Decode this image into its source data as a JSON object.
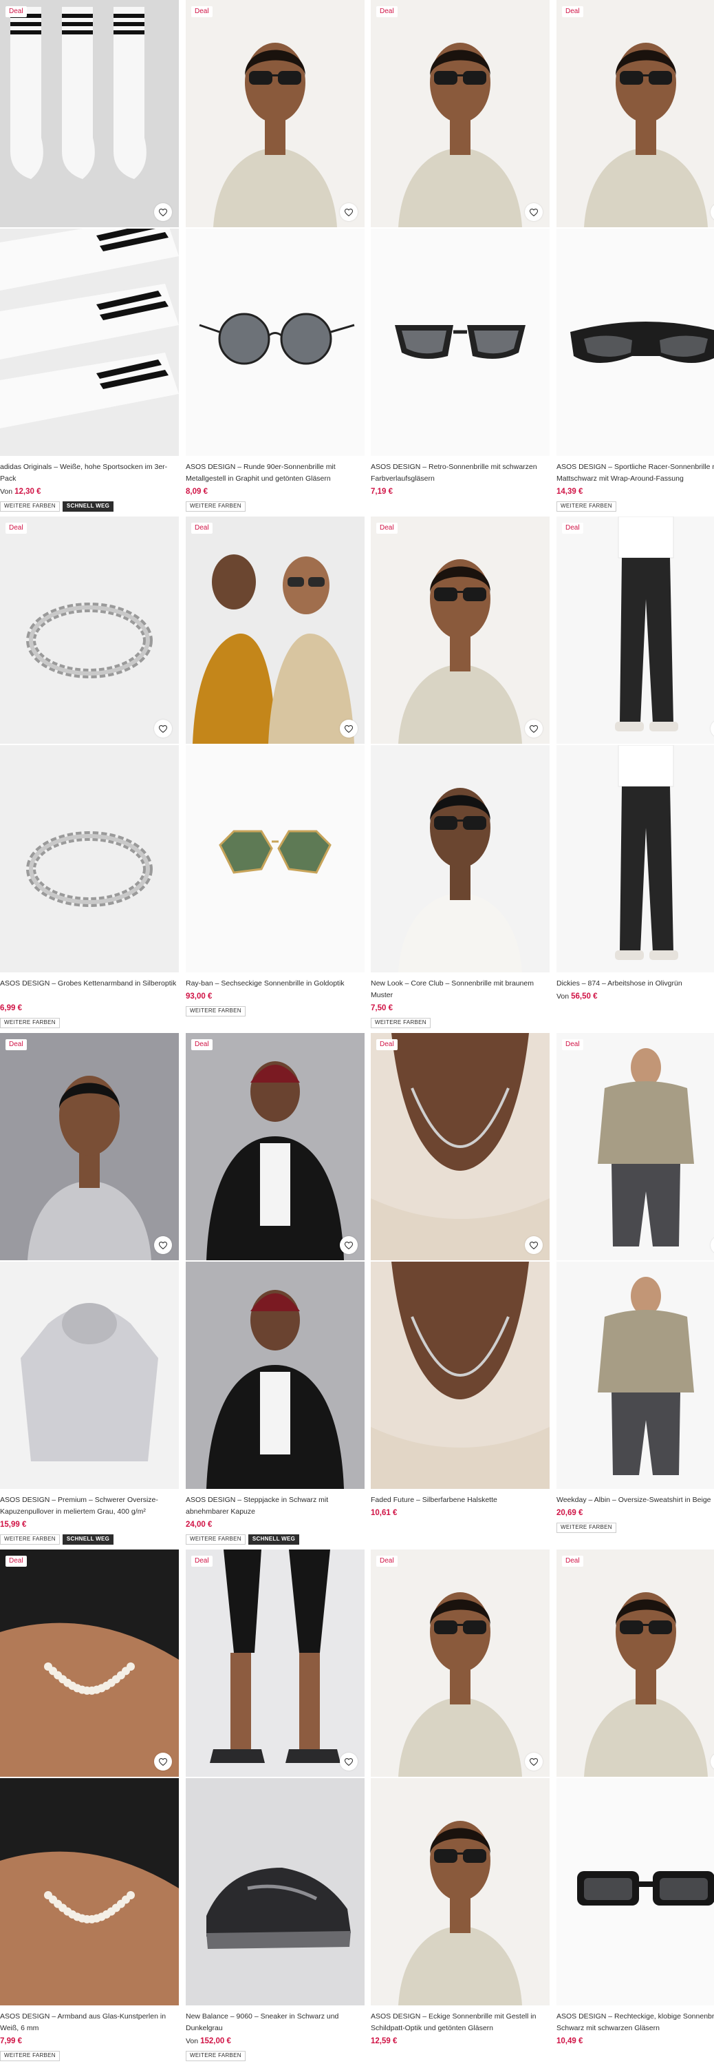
{
  "labels": {
    "deal": "Deal",
    "from": "Von",
    "more_colors": "WEITERE FARBEN",
    "selling_fast": "SCHNELL WEG"
  },
  "colors": {
    "price": "#d01345",
    "text": "#2d2d2d"
  },
  "products": [
    {
      "title": "adidas Originals – Weiße, hohe Sportsocken im 3er-Pack",
      "price": "12,30 €",
      "from": true,
      "tags": [
        "WEITERE FARBEN",
        "SCHNELL WEG"
      ],
      "imagery": [
        "socks-product-image",
        "socks-flatlay-image"
      ]
    },
    {
      "title": "ASOS DESIGN – Runde 90er-Sonnenbrille mit Metallgestell in Graphit und getönten Gläsern",
      "price": "8,09 €",
      "from": false,
      "tags": [
        "WEITERE FARBEN"
      ],
      "imagery": [
        "model-sunglasses-image",
        "round-sunglasses-image"
      ]
    },
    {
      "title": "ASOS DESIGN – Retro-Sonnenbrille mit schwarzen Farbverlaufsgläsern",
      "price": "7,19 €",
      "from": false,
      "tags": [],
      "imagery": [
        "model-sunglasses-image",
        "retro-sunglasses-image"
      ]
    },
    {
      "title": "ASOS DESIGN – Sportliche Racer-Sonnenbrille mit Mattschwarz mit Wrap-Around-Fassung",
      "price": "14,39 €",
      "from": false,
      "tags": [
        "WEITERE FARBEN"
      ],
      "imagery": [
        "model-sunglasses-image",
        "racer-sunglasses-image"
      ]
    },
    {
      "title": "ASOS DESIGN – Grobes Kettenarmband in Silberoptik",
      "price": "6,99 €",
      "from": false,
      "tags": [
        "WEITERE FARBEN"
      ],
      "imagery": [
        "bracelet-product-image",
        "bracelet-product-image"
      ]
    },
    {
      "title": "Ray-ban – Sechseckige Sonnenbrille in Goldoptik",
      "price": "93,00 €",
      "from": false,
      "tags": [
        "WEITERE FARBEN"
      ],
      "imagery": [
        "couple-sunglasses-image",
        "hexagonal-sunglasses-image"
      ]
    },
    {
      "title": "New Look – Core Club – Sonnenbrille mit braunem Muster",
      "price": "7,50 €",
      "from": false,
      "tags": [
        "WEITERE FARBEN"
      ],
      "imagery": [
        "model-sunglasses-image",
        "model-shirt-image"
      ]
    },
    {
      "title": "Dickies – 874 – Arbeitshose in Olivgrün",
      "price": "56,50 €",
      "from": true,
      "tags": [],
      "imagery": [
        "trousers-model-image",
        "trousers-model-image"
      ]
    },
    {
      "title": "ASOS DESIGN – Premium – Schwerer Oversize-Kapuzenpullover in meliertem Grau, 400 g/m²",
      "price": "15,99 €",
      "from": false,
      "tags": [
        "WEITERE FARBEN",
        "SCHNELL WEG"
      ],
      "imagery": [
        "hoodie-model-image",
        "hoodie-product-image"
      ]
    },
    {
      "title": "ASOS DESIGN – Steppjacke in Schwarz mit abnehmbarer Kapuze",
      "price": "24,00 €",
      "from": false,
      "tags": [
        "WEITERE FARBEN",
        "SCHNELL WEG"
      ],
      "imagery": [
        "jacket-model-image",
        "jacket-model-image"
      ]
    },
    {
      "title": "Faded Future – Silberfarbene Halskette",
      "price": "10,61 €",
      "from": false,
      "tags": [],
      "imagery": [
        "necklace-closeup-image",
        "necklace-closeup-image"
      ]
    },
    {
      "title": "Weekday – Albin – Oversize-Sweatshirt in Beige",
      "price": "20,69 €",
      "from": false,
      "tags": [
        "WEITERE FARBEN"
      ],
      "imagery": [
        "sweatshirt-model-image",
        "sweatshirt-model-image"
      ]
    },
    {
      "title": "ASOS DESIGN – Armband aus Glas-Kunstperlen in Weiß, 6 mm",
      "price": "7,99 €",
      "from": false,
      "tags": [
        "WEITERE FARBEN"
      ],
      "imagery": [
        "pearl-bracelet-image",
        "pearl-bracelet-image"
      ]
    },
    {
      "title": "New Balance – 9060 – Sneaker in Schwarz und Dunkelgrau",
      "price": "152,00 €",
      "from": true,
      "tags": [
        "WEITERE FARBEN"
      ],
      "imagery": [
        "sneaker-model-image",
        "sneaker-product-image"
      ]
    },
    {
      "title": "ASOS DESIGN – Eckige Sonnenbrille mit Gestell in Schildpatt-Optik und getönten Gläsern",
      "price": "12,59 €",
      "from": false,
      "tags": [],
      "imagery": [
        "model-sunglasses-image",
        "model-sunglasses-image"
      ]
    },
    {
      "title": "ASOS DESIGN – Rechteckige, klobige Sonnenbrille in Schwarz mit schwarzen Gläsern",
      "price": "10,49 €",
      "from": false,
      "tags": [],
      "imagery": [
        "model-sunglasses-image",
        "rectangle-sunglasses-image"
      ]
    }
  ]
}
